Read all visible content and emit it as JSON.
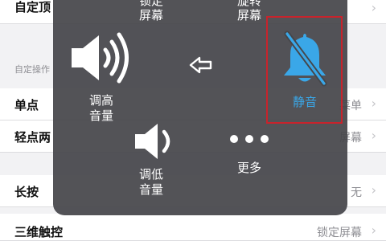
{
  "background": {
    "top_row_label": "自定顶",
    "section_header": "自定操作",
    "rows": [
      {
        "label": "单点",
        "value": "菜单"
      },
      {
        "label": "轻点两",
        "value": "屏幕"
      },
      {
        "label": "长按",
        "value": "无"
      },
      {
        "label": "三维触控",
        "value": "锁定屏幕"
      }
    ]
  },
  "panel": {
    "top_items": [
      {
        "label": "锁定\n屏幕"
      },
      {
        "label": "旋转\n屏幕"
      }
    ],
    "volume_up": {
      "label": "调高\n音量",
      "icon": "speaker-loud-icon"
    },
    "back": {
      "icon": "back-arrow-icon"
    },
    "mute": {
      "label": "静音",
      "icon": "bell-slash-icon",
      "color": "#3aa7e8"
    },
    "volume_down": {
      "label": "调低\n音量",
      "icon": "speaker-low-icon"
    },
    "more": {
      "label": "更多",
      "icon": "more-dots-icon"
    },
    "highlight_color": "#c8232c"
  }
}
